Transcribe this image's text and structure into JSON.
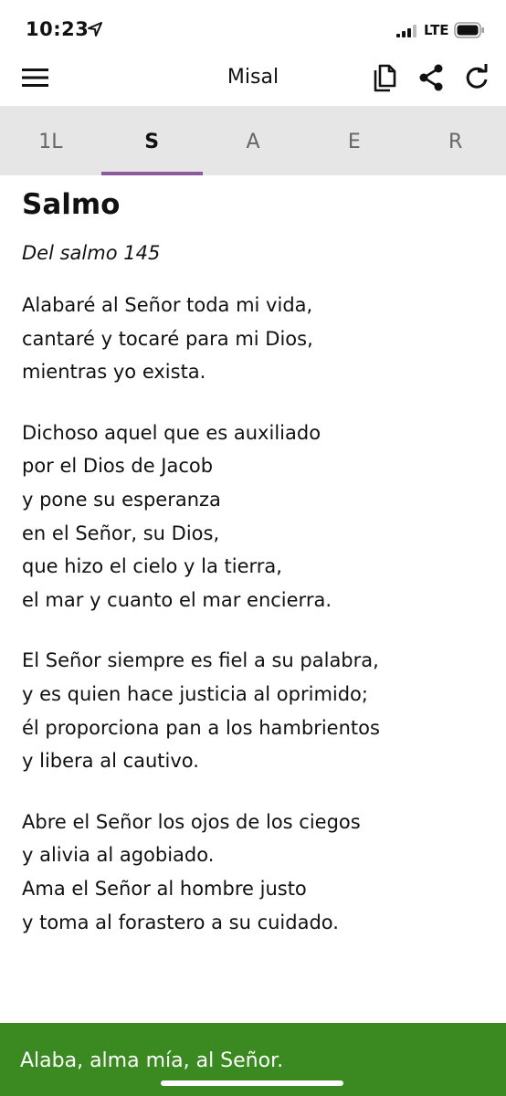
{
  "status_bar": {
    "time": "10:23",
    "network": "LTE"
  },
  "header": {
    "title": "Misal"
  },
  "tabs": [
    {
      "label": "1L",
      "active": false
    },
    {
      "label": "S",
      "active": true
    },
    {
      "label": "A",
      "active": false
    },
    {
      "label": "E",
      "active": false
    },
    {
      "label": "R",
      "active": false
    }
  ],
  "content": {
    "title": "Salmo",
    "subtitle": "Del salmo 145",
    "stanzas": [
      [
        "Alabaré al Señor toda mi vida,",
        "cantaré y tocaré para mi Dios,",
        "mientras yo exista."
      ],
      [
        "Dichoso aquel que es auxiliado",
        "por el Dios de Jacob",
        "y pone su esperanza",
        "en el Señor, su Dios,",
        "que hizo el cielo y la tierra,",
        "el mar y cuanto el mar encierra."
      ],
      [
        "El Señor siempre es fiel a su palabra,",
        "y es quien hace justicia al oprimido;",
        "él proporciona pan a los hambrientos",
        "y libera al cautivo."
      ],
      [
        "Abre el Señor los ojos de los ciegos",
        "y alivia al agobiado.",
        "Ama el Señor al hombre justo",
        "y toma al forastero a su cuidado."
      ]
    ]
  },
  "response": {
    "text": "Alaba, alma mía, al Señor."
  },
  "colors": {
    "tab_bar": "#e6e6e6",
    "tab_indicator": "#8a5a9b",
    "response_bar": "#3a8a21"
  },
  "icons": [
    "location-arrow-icon",
    "signal-icon",
    "battery-icon",
    "hamburger-menu-icon",
    "document-copy-icon",
    "share-icon",
    "refresh-icon"
  ]
}
